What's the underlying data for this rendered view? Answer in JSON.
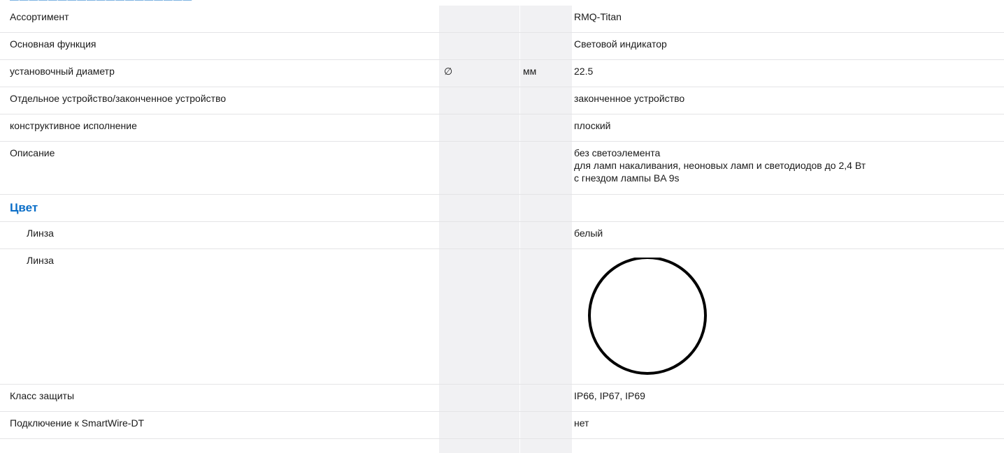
{
  "rows": [
    {
      "name": "Ассортимент",
      "symbol": "",
      "unit": "",
      "value": "RMQ-Titan"
    },
    {
      "name": "Основная функция",
      "symbol": "",
      "unit": "",
      "value": "Световой индикатор"
    },
    {
      "name": "установочный диаметр",
      "symbol": "∅",
      "unit": "мм",
      "value": "22.5"
    },
    {
      "name": "Отдельное устройство/законченное устройство",
      "symbol": "",
      "unit": "",
      "value": "законченное устройство"
    },
    {
      "name": "конструктивное исполнение",
      "symbol": "",
      "unit": "",
      "value": "плоский"
    }
  ],
  "description": {
    "name": "Описание",
    "lines": [
      "без светоэлемента",
      "для ламп накаливания, неоновых ламп и светодиодов до 2,4 Вт",
      "с гнездом лампы BA 9s"
    ]
  },
  "color_section": {
    "title": "Цвет",
    "lens_name": "Линза",
    "lens_value": "белый",
    "lens_swatch_name": "Линза",
    "lens_swatch_color": "#ffffff",
    "lens_swatch_stroke": "#000000"
  },
  "bottom_rows": [
    {
      "name": "Класс защиты",
      "value": "IP66, IP67, IP69"
    },
    {
      "name": "Подключение к SmartWire-DT",
      "value": "нет"
    }
  ],
  "colors": {
    "accent": "#0a6ec8",
    "column_shade": "#f1f1f3",
    "row_border": "#e4e4e6"
  }
}
